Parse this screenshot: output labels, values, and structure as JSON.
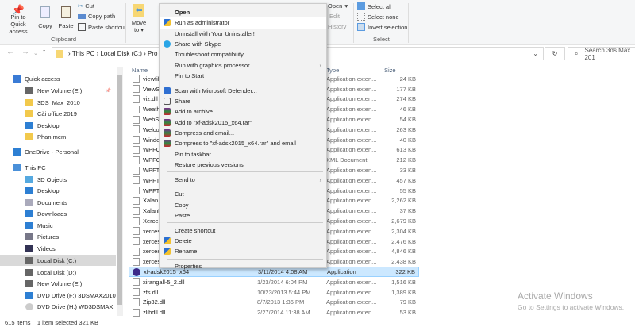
{
  "ribbon": {
    "pin": "Pin to Quick access",
    "copy": "Copy",
    "paste": "Paste",
    "cut": "Cut",
    "copy_path": "Copy path",
    "paste_shortcut": "Paste shortcut",
    "clipboard_group": "Clipboard",
    "move_to": "Move to",
    "open": "Open",
    "edit": "Edit",
    "history": "History",
    "select_all": "Select all",
    "select_none": "Select none",
    "invert_selection": "Invert selection",
    "select_group": "Select"
  },
  "address": {
    "crumbs": [
      "This PC",
      "Local Disk (C:)",
      "Pro"
    ],
    "search_placeholder": "Search 3ds Max 201"
  },
  "columns": {
    "name": "Name",
    "type": "Type",
    "size": "Size"
  },
  "sidebar": [
    {
      "label": "Quick access",
      "icon": "star-icon",
      "indent": 0
    },
    {
      "label": "New Volume (E:)",
      "icon": "drive-icon",
      "indent": 1
    },
    {
      "label": "3DS_Max_2010",
      "icon": "folder-icon",
      "indent": 1
    },
    {
      "label": "Cài office 2019",
      "icon": "folder-icon",
      "indent": 1
    },
    {
      "label": "Desktop",
      "icon": "desktop-icon",
      "indent": 1
    },
    {
      "label": "Phan mem",
      "icon": "folder-icon",
      "indent": 1
    },
    {
      "label": "OneDrive - Personal",
      "icon": "cloud-icon",
      "indent": 0
    },
    {
      "label": "This PC",
      "icon": "pc-icon",
      "indent": 0
    },
    {
      "label": "3D Objects",
      "icon": "cube-icon",
      "indent": 1
    },
    {
      "label": "Desktop",
      "icon": "desktop-icon",
      "indent": 1
    },
    {
      "label": "Documents",
      "icon": "document-icon",
      "indent": 1
    },
    {
      "label": "Downloads",
      "icon": "download-icon",
      "indent": 1
    },
    {
      "label": "Music",
      "icon": "music-icon",
      "indent": 1
    },
    {
      "label": "Pictures",
      "icon": "picture-icon",
      "indent": 1
    },
    {
      "label": "Videos",
      "icon": "video-icon",
      "indent": 1
    },
    {
      "label": "Local Disk (C:)",
      "icon": "drive-icon",
      "indent": 1,
      "selected": true
    },
    {
      "label": "Local Disk (D:)",
      "icon": "drive-icon",
      "indent": 1
    },
    {
      "label": "New Volume (E:)",
      "icon": "drive-icon",
      "indent": 1
    },
    {
      "label": "DVD Drive (F:) 3DSMAX2010",
      "icon": "dvd-icon",
      "indent": 1
    },
    {
      "label": "DVD Drive (H:) WD3DSMAX",
      "icon": "disc-icon",
      "indent": 1
    }
  ],
  "files": [
    {
      "name": "viewfil",
      "date": "",
      "type": "Application exten...",
      "size": "24 KB"
    },
    {
      "name": "ViewSy",
      "date": "",
      "type": "Application exten...",
      "size": "177 KB"
    },
    {
      "name": "viz.dll",
      "date": "",
      "type": "Application exten...",
      "size": "274 KB"
    },
    {
      "name": "Weath",
      "date": "",
      "type": "Application exten...",
      "size": "46 KB"
    },
    {
      "name": "WebSe",
      "date": "",
      "type": "Application exten...",
      "size": "54 KB"
    },
    {
      "name": "Welco",
      "date": "",
      "type": "Application exten...",
      "size": "263 KB"
    },
    {
      "name": "Windo",
      "date": "",
      "type": "Application exten...",
      "size": "40 KB"
    },
    {
      "name": "WPFC",
      "date": "",
      "type": "Application exten...",
      "size": "613 KB"
    },
    {
      "name": "WPFC",
      "date": "",
      "type": "XML Document",
      "size": "212 KB"
    },
    {
      "name": "WPFTo",
      "date": "",
      "type": "Application exten...",
      "size": "33 KB"
    },
    {
      "name": "WPFTo",
      "date": "",
      "type": "Application exten...",
      "size": "457 KB"
    },
    {
      "name": "WPFTo",
      "date": "",
      "type": "Application exten...",
      "size": "55 KB"
    },
    {
      "name": "Xalan.",
      "date": "",
      "type": "Application exten...",
      "size": "2,262 KB"
    },
    {
      "name": "XalanN",
      "date": "",
      "type": "Application exten...",
      "size": "37 KB"
    },
    {
      "name": "Xerces",
      "date": "",
      "type": "Application exten...",
      "size": "2,679 KB"
    },
    {
      "name": "xerces",
      "date": "",
      "type": "Application exten...",
      "size": "2,304 KB"
    },
    {
      "name": "xerces",
      "date": "",
      "type": "Application exten...",
      "size": "2,476 KB"
    },
    {
      "name": "xerces",
      "date": "",
      "type": "Application exten...",
      "size": "4,846 KB"
    },
    {
      "name": "xerces",
      "date": "",
      "type": "Application exten...",
      "size": "2,438 KB"
    },
    {
      "name": "xf-adsk2015_x64",
      "date": "3/11/2014 4:08 AM",
      "type": "Application",
      "size": "322 KB",
      "selected": true
    },
    {
      "name": "xirangall-5_2.dll",
      "date": "1/23/2014 6:04 PM",
      "type": "Application exten...",
      "size": "1,516 KB"
    },
    {
      "name": "zfs.dll",
      "date": "10/23/2013 5:44 PM",
      "type": "Application exten...",
      "size": "1,389 KB"
    },
    {
      "name": "Zip32.dll",
      "date": "8/7/2013 1:36 PM",
      "type": "Application exten...",
      "size": "79 KB"
    },
    {
      "name": "zlibdll.dll",
      "date": "2/27/2014 11:38 AM",
      "type": "Application exten...",
      "size": "53 KB"
    }
  ],
  "context_menu": [
    {
      "label": "Open",
      "bold": true
    },
    {
      "label": "Run as administrator",
      "icon": "shield-icon",
      "hover": true
    },
    {
      "label": "Uninstall with Your Uninstaller!"
    },
    {
      "label": "Share with Skype",
      "icon": "skype-icon"
    },
    {
      "label": "Troubleshoot compatibility"
    },
    {
      "label": "Run with graphics processor",
      "submenu": true
    },
    {
      "label": "Pin to Start"
    },
    {
      "sep": true
    },
    {
      "label": "Scan with Microsoft Defender...",
      "icon": "defender-icon"
    },
    {
      "label": "Share",
      "icon": "share-icon"
    },
    {
      "label": "Add to archive...",
      "icon": "winrar-icon"
    },
    {
      "label": "Add to \"xf-adsk2015_x64.rar\"",
      "icon": "winrar-icon"
    },
    {
      "label": "Compress and email...",
      "icon": "winrar-icon"
    },
    {
      "label": "Compress to \"xf-adsk2015_x64.rar\" and email",
      "icon": "winrar-icon"
    },
    {
      "label": "Pin to taskbar"
    },
    {
      "label": "Restore previous versions"
    },
    {
      "sep": true
    },
    {
      "label": "Send to",
      "submenu": true
    },
    {
      "sep": true
    },
    {
      "label": "Cut"
    },
    {
      "label": "Copy"
    },
    {
      "label": "Paste"
    },
    {
      "sep": true
    },
    {
      "label": "Create shortcut"
    },
    {
      "label": "Delete",
      "icon": "shield-icon"
    },
    {
      "label": "Rename",
      "icon": "shield-icon"
    },
    {
      "sep": true
    },
    {
      "label": "Properties"
    }
  ],
  "status": {
    "items": "615 items",
    "selected": "1 item selected  321 KB"
  },
  "watermark": {
    "title": "Activate Windows",
    "subtitle": "Go to Settings to activate Windows."
  },
  "colors": {
    "selection": "#cce8ff",
    "accent": "#0078d7",
    "menu_bg": "#f2f2f2"
  }
}
